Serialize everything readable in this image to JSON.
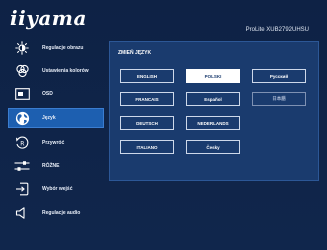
{
  "header": {
    "logo": "iiyama",
    "model": "ProLite XUB2792UHSU"
  },
  "sidebar": {
    "items": [
      {
        "label": "Regulacje obrazu",
        "icon": "brightness-icon"
      },
      {
        "label": "Ustawienia kolorów",
        "icon": "color-settings-icon"
      },
      {
        "label": "OSD",
        "icon": "osd-icon"
      },
      {
        "label": "Język",
        "icon": "globe-icon",
        "active": true
      },
      {
        "label": "Przywróć",
        "icon": "reset-icon"
      },
      {
        "label": "RÓŻNE",
        "icon": "misc-icon"
      },
      {
        "label": "Wybór wejść",
        "icon": "input-select-icon"
      },
      {
        "label": "Regulacje audio",
        "icon": "speaker-icon"
      }
    ]
  },
  "panel": {
    "title": "ZMIEŃ JĘZYK",
    "languages": [
      {
        "label": "ENGLISH"
      },
      {
        "label": "POLSKI",
        "selected": true
      },
      {
        "label": "Pусский"
      },
      {
        "label": "FRANCAIS"
      },
      {
        "label": "Español"
      },
      {
        "label": "日本語",
        "dim": true
      },
      {
        "label": "DEUTSCH"
      },
      {
        "label": "NEDERLANDS"
      },
      {
        "label": "ITALIANO"
      },
      {
        "label": "Česky"
      }
    ]
  },
  "colors": {
    "background": "#0f2244",
    "panel": "#1a3b6e",
    "active": "#1d5fb0",
    "selected": "#ffffff"
  }
}
